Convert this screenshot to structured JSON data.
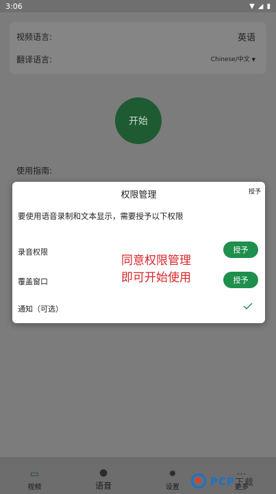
{
  "status": {
    "time": "3:06"
  },
  "background": {
    "video_language_label": "视频语言:",
    "video_language_value": "英语",
    "translate_language_label": "翻译语言:",
    "translate_language_value": "Chinese/中文",
    "start_button": "开始",
    "guide_label": "使用指南:"
  },
  "dialog": {
    "title": "权限管理",
    "corner_label": "授予",
    "description": "要使用语音录制和文本显示，需要授予以下权限",
    "permissions": [
      {
        "label": "录音权限",
        "action": "授予"
      },
      {
        "label": "覆盖窗口",
        "action": "授予"
      },
      {
        "label": "通知（可选）",
        "state": "granted"
      }
    ],
    "overlay_line1": "同意权限管理",
    "overlay_line2": "即可开始使用"
  },
  "nav": {
    "items": [
      {
        "label": "视频",
        "icon": "cast-icon"
      },
      {
        "label": "语音",
        "icon": "voice-icon"
      },
      {
        "label": "设置",
        "icon": "gear-icon"
      },
      {
        "label": "更多",
        "icon": "more-icon"
      }
    ]
  },
  "watermark": {
    "brand": "PCP",
    "suffix": "下载"
  },
  "colors": {
    "accent": "#1e8f4c",
    "overlay_red": "#d8262b",
    "start_button": "#1e5a32"
  }
}
